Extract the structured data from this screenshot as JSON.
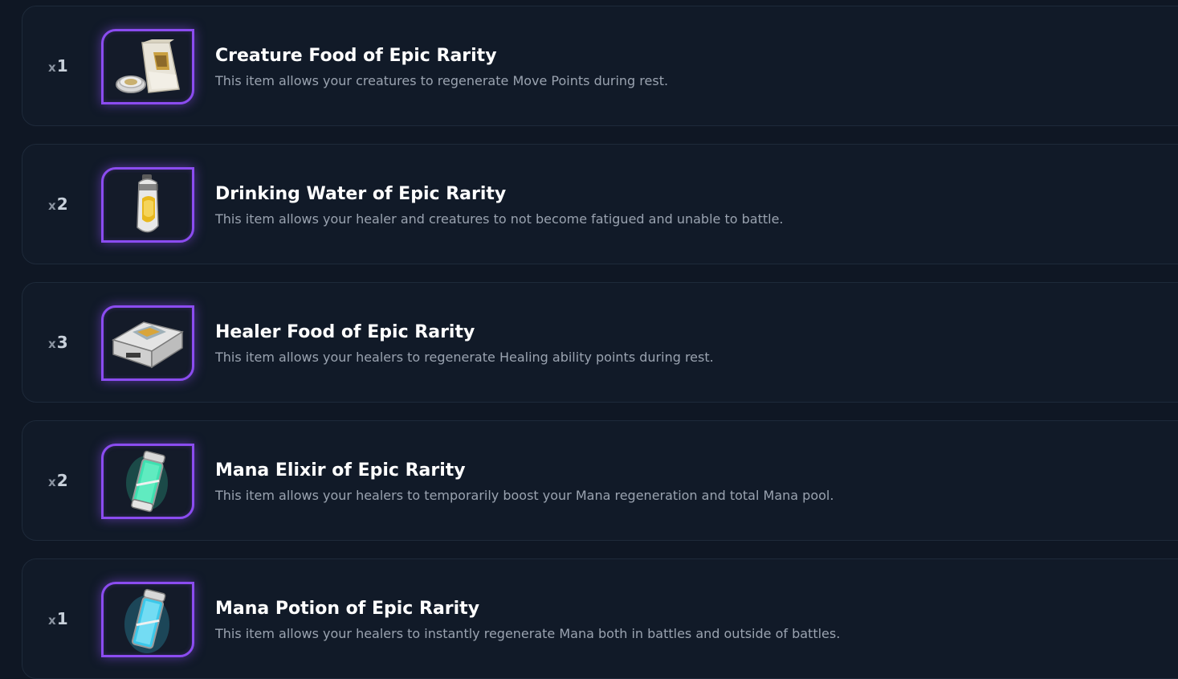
{
  "inventory": {
    "items": [
      {
        "qty_prefix": "x",
        "qty": "1",
        "title": "Creature Food of Epic Rarity",
        "description": "This item allows your creatures to regenerate Move Points during rest.",
        "icon": "food-bag-icon"
      },
      {
        "qty_prefix": "x",
        "qty": "2",
        "title": "Drinking Water of Epic Rarity",
        "description": "This item allows your healer and creatures to not become fatigued and unable to battle.",
        "icon": "water-bottle-icon"
      },
      {
        "qty_prefix": "x",
        "qty": "3",
        "title": "Healer Food of Epic Rarity",
        "description": "This item allows your healers to regenerate Healing ability points during rest.",
        "icon": "food-case-icon"
      },
      {
        "qty_prefix": "x",
        "qty": "2",
        "title": "Mana Elixir of Epic Rarity",
        "description": "This item allows your healers to temporarily boost your Mana regeneration and total Mana pool.",
        "icon": "elixir-canister-icon"
      },
      {
        "qty_prefix": "x",
        "qty": "1",
        "title": "Mana Potion of Epic Rarity",
        "description": "This item allows your healers to instantly regenerate Mana both in battles and outside of battles.",
        "icon": "potion-canister-icon"
      }
    ],
    "colors": {
      "background": "#0f1724",
      "card": "#111a28",
      "rarity_epic": "#8b4cf0",
      "title": "#ffffff",
      "description": "#9aa3b0"
    }
  }
}
